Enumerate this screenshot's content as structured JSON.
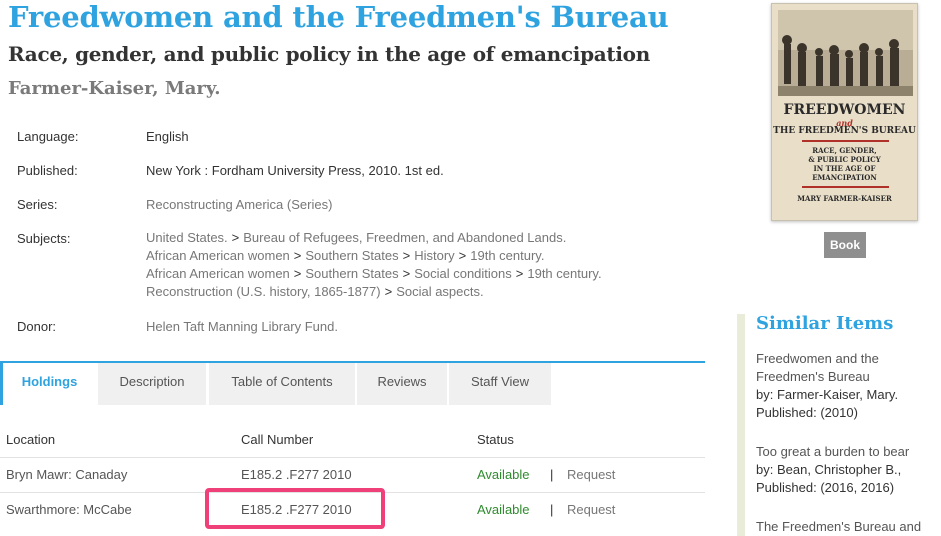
{
  "record": {
    "title": "Freedwomen and the Freedmen's Bureau",
    "subtitle": "Race, gender, and public policy in the age of emancipation",
    "author": "Farmer-Kaiser, Mary."
  },
  "details": {
    "language_label": "Language:",
    "language_value": "English",
    "published_label": "Published:",
    "published_value": "New York : Fordham University Press, 2010. 1st ed.",
    "series_label": "Series:",
    "series_value": "Reconstructing America (Series)",
    "subjects_label": "Subjects:",
    "subjects": [
      [
        "United States.",
        "Bureau of Refugees, Freedmen, and Abandoned Lands."
      ],
      [
        "African American women",
        "Southern States",
        "History",
        "19th century."
      ],
      [
        "African American women",
        "Southern States",
        "Social conditions",
        "19th century."
      ],
      [
        "Reconstruction (U.S. history, 1865-1877)",
        "Social aspects."
      ]
    ],
    "subject_separator": ">",
    "donor_label": "Donor:",
    "donor_value": "Helen Taft Manning Library Fund."
  },
  "tabs": [
    "Holdings",
    "Description",
    "Table of Contents",
    "Reviews",
    "Staff View"
  ],
  "holdings": {
    "headers": [
      "Location",
      "Call Number",
      "Status"
    ],
    "rows": [
      {
        "location": "Bryn Mawr: Canaday",
        "call_number": "E185.2 .F277 2010",
        "status": "Available",
        "separator": "|",
        "action": "Request"
      },
      {
        "location": "Swarthmore: McCabe",
        "call_number": "E185.2 .F277 2010",
        "status": "Available",
        "separator": "|",
        "action": "Request"
      }
    ]
  },
  "cover": {
    "line1": "FREEDWOMEN",
    "line2": "and",
    "line3": "THE FREEDMEN'S BUREAU",
    "line4": "RACE, GENDER,",
    "line5": "& PUBLIC POLICY",
    "line6": "IN THE AGE OF",
    "line7": "EMANCIPATION",
    "line8": "MARY FARMER-KAISER"
  },
  "format_badge": "Book",
  "similar": {
    "heading": "Similar Items",
    "items": [
      {
        "title_lines": [
          "Freedwomen and the",
          "Freedmen's Bureau"
        ],
        "by": "by: Farmer-Kaiser, Mary.",
        "published": "Published: (2010)"
      },
      {
        "title_lines": [
          "Too great a burden to bear"
        ],
        "by": "by: Bean, Christopher B.,",
        "published": "Published: (2016, 2016)"
      },
      {
        "title_lines": [
          "The Freedmen's Bureau and"
        ],
        "by": "",
        "published": ""
      }
    ]
  },
  "colors": {
    "accent": "#2ea3e0",
    "available": "#2e8b2e",
    "highlight": "#f0407a"
  }
}
